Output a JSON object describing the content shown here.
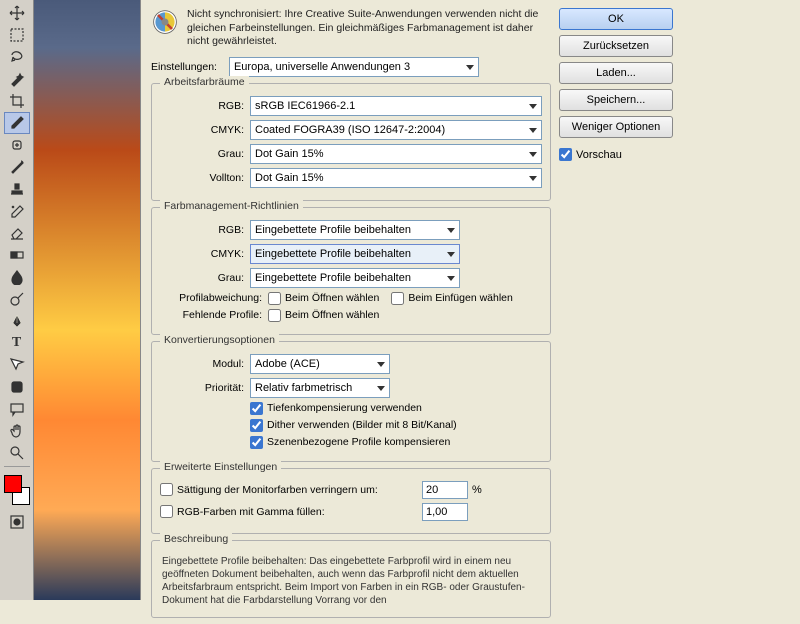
{
  "sync_message": "Nicht synchronisiert: Ihre Creative Suite-Anwendungen verwenden nicht die gleichen Farbeinstellungen. Ein gleichmäßiges Farbmanagement ist daher nicht gewährleistet.",
  "settings_label": "Einstellungen:",
  "settings_value": "Europa, universelle Anwendungen 3",
  "workspaces": {
    "title": "Arbeitsfarbräume",
    "rgb_label": "RGB:",
    "rgb_value": "sRGB IEC61966-2.1",
    "cmyk_label": "CMYK:",
    "cmyk_value": "Coated FOGRA39 (ISO 12647-2:2004)",
    "gray_label": "Grau:",
    "gray_value": "Dot Gain 15%",
    "spot_label": "Vollton:",
    "spot_value": "Dot Gain 15%"
  },
  "policies": {
    "title": "Farbmanagement-Richtlinien",
    "rgb_label": "RGB:",
    "rgb_value": "Eingebettete Profile beibehalten",
    "cmyk_label": "CMYK:",
    "cmyk_value": "Eingebettete Profile beibehalten",
    "gray_label": "Grau:",
    "gray_value": "Eingebettete Profile beibehalten",
    "mismatch_label": "Profilabweichung:",
    "open_cb": "Beim Öffnen wählen",
    "paste_cb": "Beim Einfügen wählen",
    "missing_label": "Fehlende Profile:",
    "missing_cb": "Beim Öffnen wählen"
  },
  "conversion": {
    "title": "Konvertierungsoptionen",
    "engine_label": "Modul:",
    "engine_value": "Adobe (ACE)",
    "intent_label": "Priorität:",
    "intent_value": "Relativ farbmetrisch",
    "bpc": "Tiefenkompensierung verwenden",
    "dither": "Dither verwenden (Bilder mit 8 Bit/Kanal)",
    "scene": "Szenenbezogene Profile kompensieren"
  },
  "advanced": {
    "title": "Erweiterte Einstellungen",
    "desat": "Sättigung der Monitorfarben verringern um:",
    "desat_val": "20",
    "desat_unit": "%",
    "gamma": "RGB-Farben mit Gamma füllen:",
    "gamma_val": "1,00"
  },
  "description": {
    "title": "Beschreibung",
    "text": "Eingebettete Profile beibehalten: Das eingebettete Farbprofil wird in einem neu geöffneten Dokument beibehalten, auch wenn das Farbprofil nicht dem aktuellen Arbeitsfarbraum entspricht. Beim Import von Farben in ein RGB- oder Graustufen-Dokument hat die Farbdarstellung Vorrang vor den"
  },
  "buttons": {
    "ok": "OK",
    "cancel": "Zurücksetzen",
    "load": "Laden...",
    "save": "Speichern...",
    "fewer": "Weniger Optionen",
    "preview": "Vorschau"
  }
}
